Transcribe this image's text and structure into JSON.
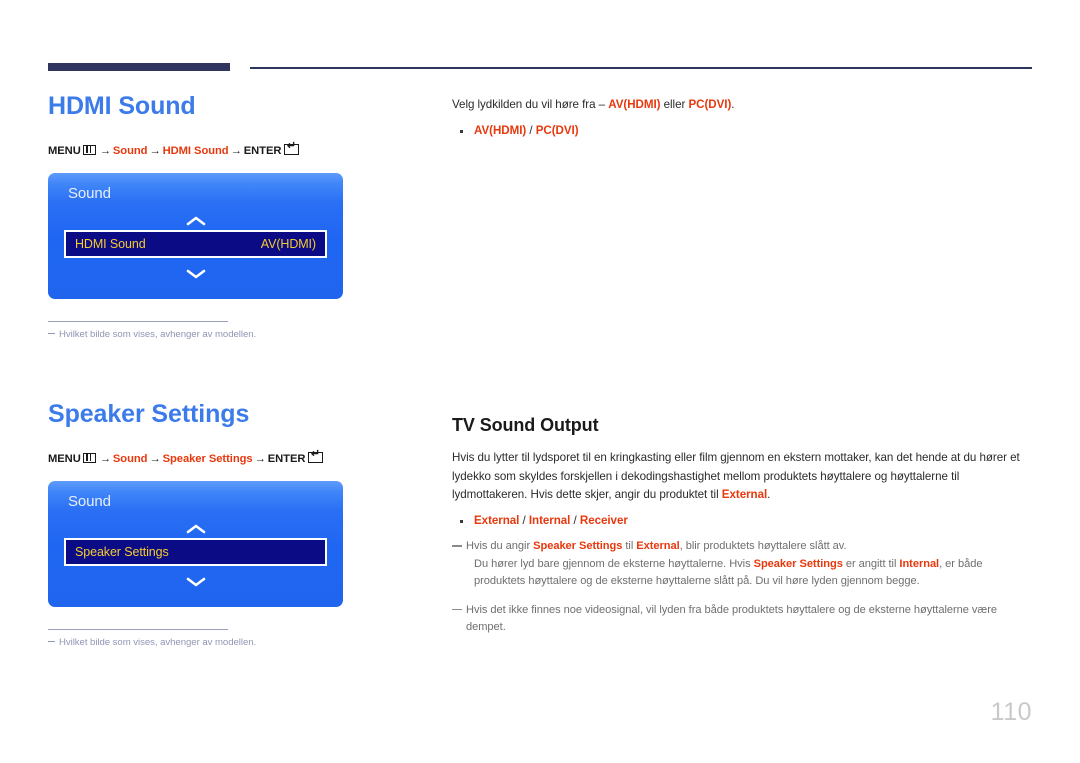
{
  "page": {
    "number": "110"
  },
  "sections": {
    "hdmi_sound": {
      "title": "HDMI Sound",
      "menu_path": {
        "menu_label": "MENU",
        "menu_icon": "menu-grid-icon",
        "step1": "Sound",
        "step2": "HDMI Sound",
        "enter_label": "ENTER",
        "enter_icon": "enter-return-icon",
        "arrow": "→"
      },
      "osd": {
        "title": "Sound",
        "up_arrow_icon": "chevron-up-icon",
        "down_arrow_icon": "chevron-down-icon",
        "row_label": "HDMI Sound",
        "row_value": "AV(HDMI)"
      },
      "footnote": "Hvilket bilde som vises, avhenger av modellen.",
      "description": {
        "intro_pre": "Velg lydkilden du vil høre fra – ",
        "intro_opt1": "AV(HDMI)",
        "intro_mid": " eller ",
        "intro_opt2": "PC(DVI)",
        "intro_post": ".",
        "bullet": "AV(HDMI) / PC(DVI)",
        "bullet_opt1": "AV(HDMI)",
        "bullet_sep": " / ",
        "bullet_opt2": "PC(DVI)"
      }
    },
    "speaker_settings": {
      "title": "Speaker Settings",
      "menu_path": {
        "menu_label": "MENU",
        "menu_icon": "menu-grid-icon",
        "step1": "Sound",
        "step2": "Speaker Settings",
        "enter_label": "ENTER",
        "enter_icon": "enter-return-icon",
        "arrow": "→"
      },
      "osd": {
        "title": "Sound",
        "up_arrow_icon": "chevron-up-icon",
        "down_arrow_icon": "chevron-down-icon",
        "row_label": "Speaker Settings",
        "row_value": ""
      },
      "footnote": "Hvilket bilde som vises, avhenger av modellen.",
      "tv_sound_output": {
        "heading": "TV Sound Output",
        "para_1a": "Hvis du lytter til lydsporet til en kringkasting eller film gjennom en ekstern mottaker, kan det hende at du hører et lydekko som skyldes forskjellen i dekodingshastighet mellom produktets høyttalere og høyttalerne til lydmottakeren. Hvis dette skjer, angir du produktet til ",
        "para_1_red": "External",
        "para_1b": ".",
        "bullet_opt1": "External",
        "bullet_sep1": " / ",
        "bullet_opt2": "Internal",
        "bullet_sep2": " / ",
        "bullet_opt3": "Receiver",
        "note_1a": "Hvis du angir ",
        "note_1_red1": "Speaker Settings",
        "note_1b": " til ",
        "note_1_red2": "External",
        "note_1c": ", blir produktets høyttalere slått av.",
        "note_1d": "Du hører lyd bare gjennom de eksterne høyttalerne. Hvis ",
        "note_1_red3": "Speaker Settings",
        "note_1e": " er angitt til ",
        "note_1_red4": "Internal",
        "note_1f": ", er både produktets høyttalere og de eksterne høyttalerne slått på. Du vil høre lyden gjennom begge.",
        "note_2": "Hvis det ikke finnes noe videosignal, vil lyden fra både produktets høyttalere og de eksterne høyttalerne være dempet."
      }
    }
  },
  "colors": {
    "heading_blue": "#3c7bea",
    "accent_red": "#e8380d",
    "rule_navy": "#30355f",
    "osd_blue": "#2065ee",
    "osd_row_navy": "#0b0b86",
    "osd_row_yellow": "#f5cb2e",
    "footnote_gray": "#9096b4",
    "page_num_gray": "#c9c9c9"
  }
}
